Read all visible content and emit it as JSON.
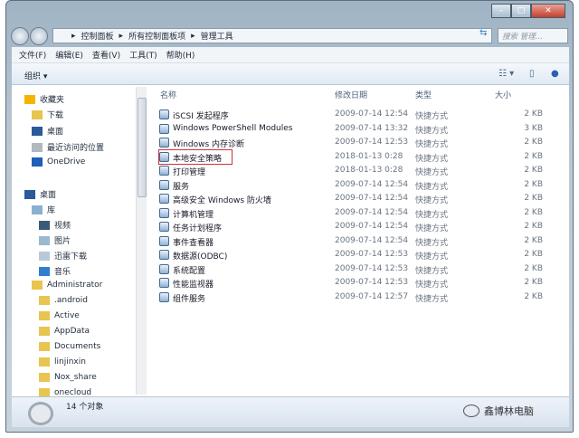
{
  "window": {
    "controls": [
      "minimize",
      "maximize",
      "close"
    ]
  },
  "address": {
    "crumbs": [
      "控制面板",
      "所有控制面板项",
      "管理工具"
    ],
    "search_placeholder": "搜索 管理..."
  },
  "menu": [
    "文件(F)",
    "编辑(E)",
    "查看(V)",
    "工具(T)",
    "帮助(H)"
  ],
  "toolbar": {
    "organize": "组织 ▾"
  },
  "nav": [
    {
      "label": "收藏夹",
      "icon": "star-icon",
      "indent": 0
    },
    {
      "label": "下载",
      "icon": "download-folder-icon",
      "indent": 1
    },
    {
      "label": "桌面",
      "icon": "desktop-icon",
      "indent": 1
    },
    {
      "label": "最近访问的位置",
      "icon": "recent-icon",
      "indent": 1
    },
    {
      "label": "OneDrive",
      "icon": "cloud-icon",
      "indent": 1
    },
    {
      "label": "桌面",
      "icon": "desktop-icon",
      "indent": 0
    },
    {
      "label": "库",
      "icon": "library-icon",
      "indent": 1
    },
    {
      "label": "视频",
      "icon": "video-icon",
      "indent": 2
    },
    {
      "label": "图片",
      "icon": "picture-icon",
      "indent": 2
    },
    {
      "label": "迅雷下载",
      "icon": "document-icon",
      "indent": 2
    },
    {
      "label": "音乐",
      "icon": "music-icon",
      "indent": 2
    },
    {
      "label": "Administrator",
      "icon": "user-folder-icon",
      "indent": 1
    },
    {
      "label": ".android",
      "icon": "folder-icon",
      "indent": 2
    },
    {
      "label": "Active",
      "icon": "folder-icon",
      "indent": 2
    },
    {
      "label": "AppData",
      "icon": "folder-icon",
      "indent": 2
    },
    {
      "label": "Documents",
      "icon": "folder-icon",
      "indent": 2
    },
    {
      "label": "linjinxin",
      "icon": "folder-icon",
      "indent": 2
    },
    {
      "label": "Nox_share",
      "icon": "folder-icon",
      "indent": 2
    },
    {
      "label": "onecloud",
      "icon": "folder-icon",
      "indent": 2
    }
  ],
  "columns": {
    "name": "名称",
    "date": "修改日期",
    "type": "类型",
    "size": "大小"
  },
  "files": [
    {
      "name": "iSCSI 发起程序",
      "date": "2009-07-14 12:54",
      "type": "快捷方式",
      "size": "2 KB"
    },
    {
      "name": "Windows PowerShell Modules",
      "date": "2009-07-14 13:32",
      "type": "快捷方式",
      "size": "3 KB"
    },
    {
      "name": "Windows 内存诊断",
      "date": "2009-07-14 12:53",
      "type": "快捷方式",
      "size": "2 KB"
    },
    {
      "name": "本地安全策略",
      "date": "2018-01-13 0:28",
      "type": "快捷方式",
      "size": "2 KB"
    },
    {
      "name": "打印管理",
      "date": "2018-01-13 0:28",
      "type": "快捷方式",
      "size": "2 KB"
    },
    {
      "name": "服务",
      "date": "2009-07-14 12:54",
      "type": "快捷方式",
      "size": "2 KB"
    },
    {
      "name": "高级安全 Windows 防火墙",
      "date": "2009-07-14 12:54",
      "type": "快捷方式",
      "size": "2 KB"
    },
    {
      "name": "计算机管理",
      "date": "2009-07-14 12:54",
      "type": "快捷方式",
      "size": "2 KB"
    },
    {
      "name": "任务计划程序",
      "date": "2009-07-14 12:54",
      "type": "快捷方式",
      "size": "2 KB"
    },
    {
      "name": "事件查看器",
      "date": "2009-07-14 12:54",
      "type": "快捷方式",
      "size": "2 KB"
    },
    {
      "name": "数据源(ODBC)",
      "date": "2009-07-14 12:53",
      "type": "快捷方式",
      "size": "2 KB"
    },
    {
      "name": "系统配置",
      "date": "2009-07-14 12:53",
      "type": "快捷方式",
      "size": "2 KB"
    },
    {
      "name": "性能监视器",
      "date": "2009-07-14 12:53",
      "type": "快捷方式",
      "size": "2 KB"
    },
    {
      "name": "组件服务",
      "date": "2009-07-14 12:57",
      "type": "快捷方式",
      "size": "2 KB"
    }
  ],
  "status": {
    "count": "14 个对象"
  },
  "watermark": "鑫博林电脑",
  "colors": {
    "highlight": "#d0303a"
  }
}
